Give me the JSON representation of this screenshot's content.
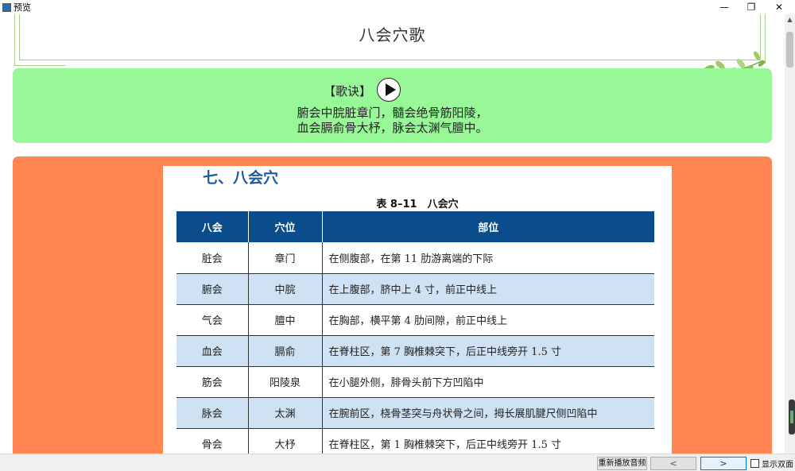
{
  "window": {
    "title": "预览",
    "min_label": "—",
    "max_label": "❐",
    "close_label": "✕"
  },
  "page": {
    "title": "八会穴歌"
  },
  "verse": {
    "heading": "【歌诀】",
    "line1": "腑会中脘脏章门，髓会绝骨筋阳陵，",
    "line2": "血会膈俞骨大杼，脉会太渊气膻中。"
  },
  "document": {
    "section_title": "七、八会穴",
    "table_caption": "表 8–11　八会穴",
    "headers": [
      "八会",
      "穴位",
      "部位"
    ],
    "rows": [
      [
        "脏会",
        "章门",
        "在侧腹部，在第 11 肋游离端的下际"
      ],
      [
        "腑会",
        "中脘",
        "在上腹部，脐中上 4 寸，前正中线上"
      ],
      [
        "气会",
        "膻中",
        "在胸部，横平第 4 肋间隙，前正中线上"
      ],
      [
        "血会",
        "膈俞",
        "在脊柱区，第 7 胸椎棘突下，后正中线旁开 1.5 寸"
      ],
      [
        "筋会",
        "阳陵泉",
        "在小腿外侧，腓骨头前下方凹陷中"
      ],
      [
        "脉会",
        "太渊",
        "在腕前区，桡骨茎突与舟状骨之间，拇长展肌腱尺侧凹陷中"
      ],
      [
        "骨会",
        "大杼",
        "在脊柱区，第 1 胸椎棘突下，后正中线旁开 1.5 寸"
      ]
    ]
  },
  "statusbar": {
    "replay_label": "重新播放音频",
    "prev_label": "<",
    "next_label": ">",
    "dual_page_label": "显示双面",
    "dual_page_checked": false
  },
  "colors": {
    "verse_panel": "#98f898",
    "image_panel": "#ff8650",
    "table_header": "#0b4c8c",
    "table_alt_row": "#cfe2f3"
  }
}
